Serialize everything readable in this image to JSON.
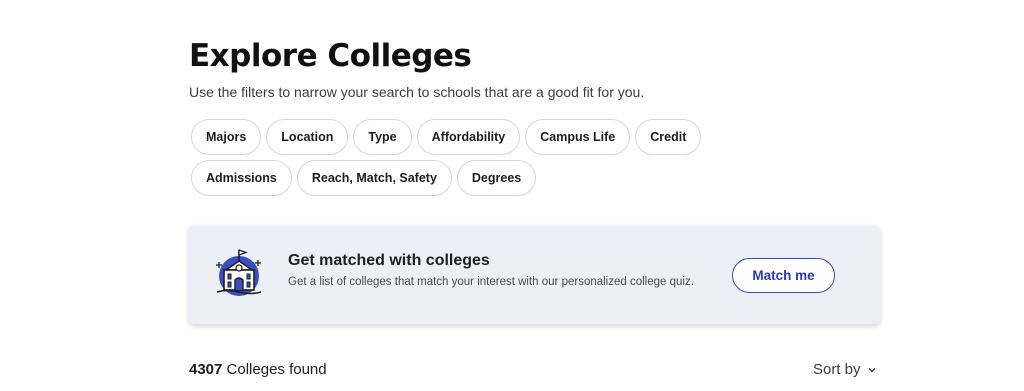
{
  "header": {
    "title": "Explore Colleges",
    "subtitle": "Use the filters to narrow your search to schools that are a good fit for you."
  },
  "filters": [
    "Majors",
    "Location",
    "Type",
    "Affordability",
    "Campus Life",
    "Credit",
    "Admissions",
    "Reach, Match, Safety",
    "Degrees"
  ],
  "match_card": {
    "icon": "college-building-icon",
    "title": "Get matched with colleges",
    "description": "Get a list of colleges that match your interest with our personalized college quiz.",
    "button_label": "Match me",
    "accent_color": "#3649c8",
    "background_color": "#eceff6"
  },
  "results": {
    "count": "4307",
    "label": " Colleges found",
    "sort_label": "Sort by",
    "sort_icon": "chevron-down-icon"
  }
}
